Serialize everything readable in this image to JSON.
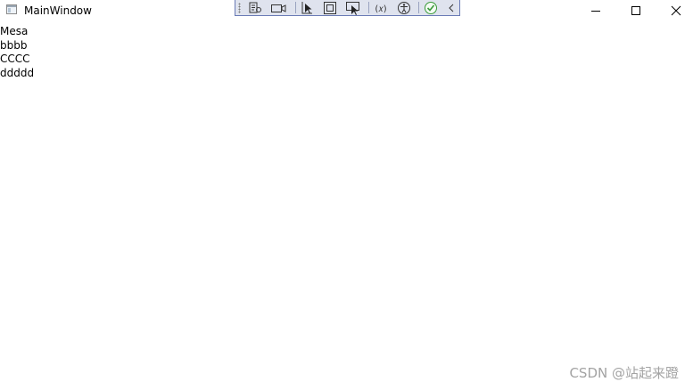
{
  "window": {
    "title": "MainWindow"
  },
  "debug_toolbar": {
    "tools": [
      {
        "icon": "live-visual-tree-icon"
      },
      {
        "icon": "camera-icon"
      },
      {
        "icon": "select-element-icon"
      },
      {
        "icon": "display-layout-adorners-icon"
      },
      {
        "icon": "track-focused-element-icon"
      },
      {
        "icon": "binding-failures-icon"
      },
      {
        "icon": "accessibility-icon"
      },
      {
        "icon": "hot-reload-ok-icon"
      },
      {
        "icon": "collapse-chevron-icon"
      }
    ],
    "colors": {
      "background": "#dfe3ee",
      "border": "#6a7bb6",
      "ok_green": "#3a9a3a"
    }
  },
  "content": {
    "items": [
      "Mesa",
      "bbbb",
      "CCCC",
      "ddddd"
    ]
  },
  "watermark": {
    "text": "CSDN @站起来蹬"
  }
}
